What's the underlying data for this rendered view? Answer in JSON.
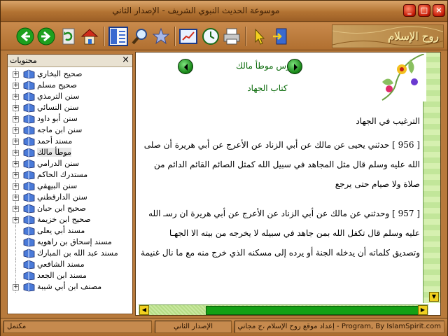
{
  "window": {
    "title": "موسوعة الحديث النبوي الشريف - الإصدار الثاني",
    "controls": [
      "minimize",
      "maximize",
      "close"
    ]
  },
  "toolbar": {
    "buttons": [
      {
        "name": "back-button",
        "icon": "arrow-left-icon"
      },
      {
        "name": "forward-button",
        "icon": "arrow-right-icon"
      },
      {
        "name": "refresh-button",
        "icon": "refresh-icon"
      },
      {
        "name": "home-button",
        "icon": "home-icon"
      },
      {
        "name": "contents-toggle-button",
        "icon": "panel-icon"
      },
      {
        "name": "search-button",
        "icon": "magnifier-icon"
      },
      {
        "name": "favorites-button",
        "icon": "star-icon"
      },
      {
        "name": "export-button",
        "icon": "chart-icon"
      },
      {
        "name": "history-button",
        "icon": "clock-icon"
      },
      {
        "name": "print-button",
        "icon": "printer-icon"
      },
      {
        "name": "pointer-button",
        "icon": "pointer-icon"
      },
      {
        "name": "exit-button",
        "icon": "door-exit-icon"
      }
    ],
    "banner_text": "روح الإسلام"
  },
  "tree": {
    "title": "محتويات",
    "close": "×",
    "items": [
      {
        "label": "صحيح البخاري",
        "expandable": true
      },
      {
        "label": "صحيح مسلم",
        "expandable": true
      },
      {
        "label": "سنن الترمذي",
        "expandable": true
      },
      {
        "label": "سنن النسائي",
        "expandable": true
      },
      {
        "label": "سنن أبو داود",
        "expandable": true
      },
      {
        "label": "سنن ابن ماجه",
        "expandable": true
      },
      {
        "label": "مسند أحمد",
        "expandable": true
      },
      {
        "label": "موطأ مالك",
        "expandable": true,
        "selected": true
      },
      {
        "label": "سنن الدرامي",
        "expandable": true
      },
      {
        "label": "مستدرك الحاكم",
        "expandable": true
      },
      {
        "label": "سنن البيهقي",
        "expandable": true
      },
      {
        "label": "سنن الدارقطني",
        "expandable": true
      },
      {
        "label": "صحيح ابن حبان",
        "expandable": true
      },
      {
        "label": "صحيح ابن خزيمة",
        "expandable": true
      },
      {
        "label": "مسند أبي يعلى",
        "expandable": false
      },
      {
        "label": "مسند إسحاق بن راهويه",
        "expandable": false
      },
      {
        "label": "مسند عبد الله بن المبارك",
        "expandable": false
      },
      {
        "label": "مسند الشافعي",
        "expandable": false
      },
      {
        "label": "مسند ابن الجعد",
        "expandable": false
      },
      {
        "label": "مصنف ابن أبي شيبة",
        "expandable": true
      }
    ]
  },
  "content": {
    "index_title": "فهرس موطأ مالك",
    "chapter_title": "كتاب الجهاد",
    "section_heading": "الترغيب في الجهاد",
    "hadith_1": "[ 956 ] حدثني يحيى عن مالك عن أبي الزناد عن الأعرج عن أبي هريرة أن صلى الله عليه وسلم قال مثل المجاهد في سبيل الله كمثل الصائم القائم الدائم من صلاة ولا صيام حتى يرجع",
    "hadith_2": "[ 957 ] وحدثني عن مالك عن أبي الزناد عن الأعرج عن أبي هريرة ان رسـ الله عليه وسلم قال تكفل الله بمن جاهد في سبيله لا يخرجه من بيته الا الجهـا وتصديق كلماته أن يدخله الجنة أو يرده إلى مسكنه الذي خرج منه مع ما نال غنيمة"
  },
  "statusbar": {
    "left": "مكتمل",
    "middle": "الإصدار الثاني",
    "right": "Program, By IslamSpirit.com - إعداد موقع روح الإسلام ،ج مجاني"
  }
}
